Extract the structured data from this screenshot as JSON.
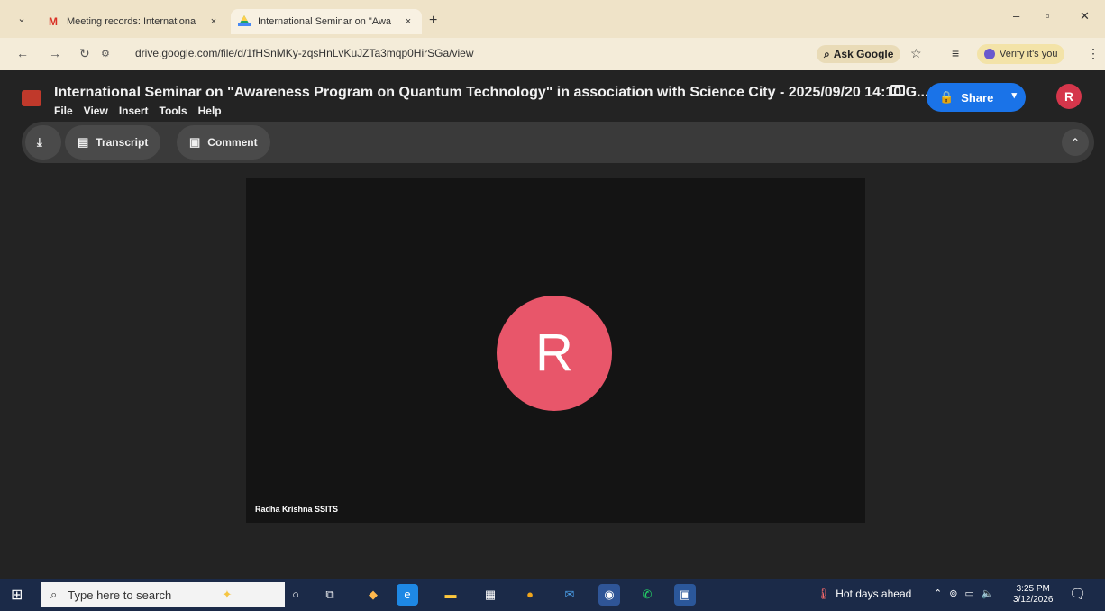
{
  "browser": {
    "tabs": [
      {
        "title": "Meeting records: Internationa",
        "icon": "gmail-icon",
        "close": "×"
      },
      {
        "title": "International Seminar on \"Awa",
        "icon": "drive-icon",
        "close": "×"
      }
    ],
    "new_tab": "+",
    "menu_chevron": "⌄",
    "window_controls": {
      "minimize": "–",
      "maximize": "▫",
      "close": "✕"
    }
  },
  "address_bar": {
    "url": "drive.google.com/file/d/1fHSnMKy-zqsHnLvKuJZTa3mqp0HirSGa/view",
    "ask_google": "Ask Google",
    "verify": "Verify it's you"
  },
  "viewer": {
    "title": "International Seminar on \"Awareness Program on Quantum Technology\" in association with Science City - 2025/09/20 14:10 G...",
    "menus": [
      "File",
      "View",
      "Insert",
      "Tools",
      "Help"
    ],
    "share_label": "Share",
    "account_initial": "R",
    "toolbar": {
      "transcript": "Transcript",
      "comment": "Comment"
    },
    "video": {
      "participant_initial": "R",
      "participant_name": "Radha Krishna SSITS",
      "avatar_color": "#e8566a"
    }
  },
  "taskbar": {
    "search_placeholder": "Type here to search",
    "weather": "Hot days ahead",
    "time": "3:25 PM",
    "date": "3/12/2026"
  },
  "colors": {
    "share_blue": "#1a73e8",
    "account_red": "#d5364b",
    "taskbar": "#1b2a48"
  }
}
